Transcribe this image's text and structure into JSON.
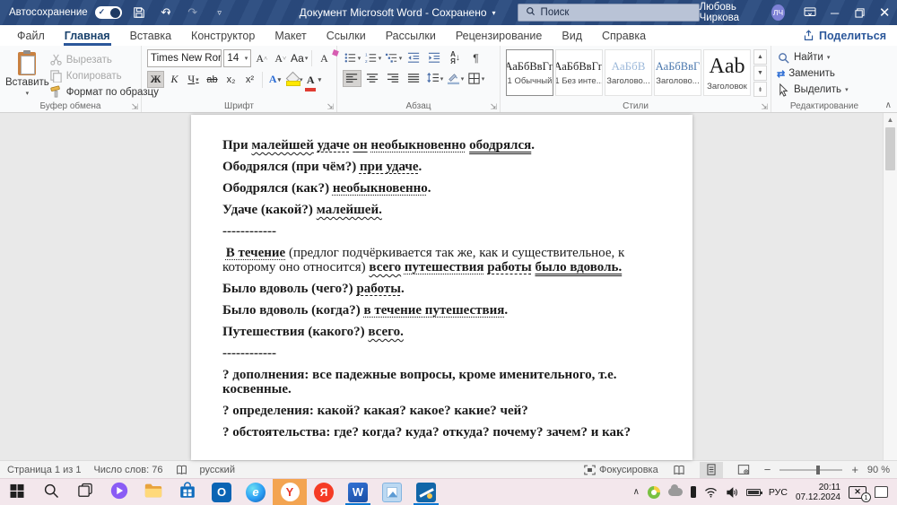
{
  "titlebar": {
    "autosave_label": "Автосохранение",
    "doc_title": "Документ Microsoft Word - Сохранено",
    "search_placeholder": "Поиск",
    "user_name": "Любовь Чиркова",
    "user_initials": "ЛЧ"
  },
  "tabs": {
    "items": [
      "Файл",
      "Главная",
      "Вставка",
      "Конструктор",
      "Макет",
      "Ссылки",
      "Рассылки",
      "Рецензирование",
      "Вид",
      "Справка"
    ],
    "active": "Главная",
    "share_label": "Поделиться"
  },
  "ribbon": {
    "clipboard": {
      "paste": "Вставить",
      "cut": "Вырезать",
      "copy": "Копировать",
      "format_painter": "Формат по образцу",
      "group": "Буфер обмена"
    },
    "font": {
      "family": "Times New Ror",
      "size": "14",
      "bold": "Ж",
      "italic": "K",
      "underline": "Ч",
      "strike": "ab",
      "sub": "x₂",
      "sup": "x²",
      "effects": "А",
      "case_btn": "Аа",
      "grow": "А",
      "shrink": "А",
      "clear": "А",
      "color": "А",
      "group": "Шрифт"
    },
    "paragraph": {
      "sort_top": "А",
      "sort_bottom": "Я",
      "pilcrow": "¶",
      "group": "Абзац"
    },
    "styles": {
      "group": "Стили",
      "items": [
        {
          "preview": "АаБбВвГг,",
          "name": "1 Обычный",
          "variant": "normal",
          "selected": true
        },
        {
          "preview": "АаБбВвГг,",
          "name": "1 Без инте...",
          "variant": "normal",
          "selected": false
        },
        {
          "preview": "АаБбВ",
          "name": "Заголово...",
          "variant": "h1",
          "selected": false
        },
        {
          "preview": "АаБбВвГ",
          "name": "Заголово...",
          "variant": "h2",
          "selected": false
        },
        {
          "preview": "Aab",
          "name": "Заголовок",
          "variant": "title",
          "selected": false
        }
      ]
    },
    "editing": {
      "find": "Найти",
      "replace": "Заменить",
      "select": "Выделить",
      "group": "Редактирование"
    }
  },
  "document": {
    "lines": [
      {
        "segments": [
          {
            "t": "При "
          },
          {
            "t": "малейшей",
            "u": "wavy"
          },
          {
            "t": " "
          },
          {
            "t": "удаче",
            "u": "dashed"
          },
          {
            "t": " "
          },
          {
            "t": "он",
            "u": "solid"
          },
          {
            "t": " "
          },
          {
            "t": "необыкновенно",
            "u": "dotted"
          },
          {
            "t": " "
          },
          {
            "t": "ободрялся",
            "u": "double"
          },
          {
            "t": "."
          }
        ]
      },
      {
        "segments": [
          {
            "t": "Ободрялся (при чём?) "
          },
          {
            "t": "при удаче",
            "u": "dashed"
          },
          {
            "t": "."
          }
        ]
      },
      {
        "segments": [
          {
            "t": "Ободрялся (как?) "
          },
          {
            "t": "необыкновенно",
            "u": "dotted"
          },
          {
            "t": "."
          }
        ]
      },
      {
        "segments": [
          {
            "t": "Удаче (какой?) "
          },
          {
            "t": "малейшей.",
            "u": "wavy"
          }
        ]
      },
      {
        "segments": [
          {
            "t": "------------"
          }
        ]
      },
      {
        "segments": [
          {
            "t": " "
          },
          {
            "t": "В течение",
            "u": "dotted"
          },
          {
            "t": " "
          },
          {
            "t": "(предлог подчёркивается так же, как и существительное, к которому оно относится) ",
            "n": true
          },
          {
            "t": "всего",
            "u": "wavy"
          },
          {
            "t": " "
          },
          {
            "t": "путешествия",
            "u": "dotted"
          },
          {
            "t": " "
          },
          {
            "t": "работы",
            "u": "dashed"
          },
          {
            "t": " "
          },
          {
            "t": "было вдоволь.",
            "u": "double"
          }
        ]
      },
      {
        "segments": [
          {
            "t": "Было вдоволь (чего?) "
          },
          {
            "t": "работы",
            "u": "dashed"
          },
          {
            "t": "."
          }
        ]
      },
      {
        "segments": [
          {
            "t": "Было вдоволь (когда?) "
          },
          {
            "t": "в течение путешествия",
            "u": "dotted"
          },
          {
            "t": "."
          }
        ]
      },
      {
        "segments": [
          {
            "t": "Путешествия (какого?) "
          },
          {
            "t": "всего.",
            "u": "wavy"
          }
        ]
      },
      {
        "segments": [
          {
            "t": "------------"
          }
        ]
      },
      {
        "segments": [
          {
            "t": "? дополнения: все падежные вопросы, кроме именительного, т.е. косвенные."
          }
        ]
      },
      {
        "segments": [
          {
            "t": "? определения: какой? какая? какое? какие? чей?"
          }
        ]
      },
      {
        "segments": [
          {
            "t": "? обстоятельства: где? когда? куда? откуда? почему? зачем? и как?"
          }
        ]
      }
    ]
  },
  "statusbar": {
    "page": "Страница 1 из 1",
    "words": "Число слов: 76",
    "language": "русский",
    "focus": "Фокусировка",
    "zoom": "90 %"
  },
  "taskbar": {
    "apps": [
      {
        "name": "start"
      },
      {
        "name": "search"
      },
      {
        "name": "task-view"
      },
      {
        "name": "alice"
      },
      {
        "name": "explorer"
      },
      {
        "name": "store"
      },
      {
        "name": "outlook",
        "glyph": "O",
        "cls": "tile outlook"
      },
      {
        "name": "edge",
        "glyph": "e",
        "cls": "tile edge"
      },
      {
        "name": "yandex-browser",
        "glyph": "Y",
        "cls": "circle ybrowser",
        "highlight": true
      },
      {
        "name": "yandex",
        "glyph": "Я",
        "cls": "circle yandex"
      },
      {
        "name": "word",
        "glyph": "W",
        "cls": "tile word",
        "active": true
      },
      {
        "name": "photos",
        "cls": "photos-ic"
      },
      {
        "name": "snipping",
        "cls": "snip-ic",
        "active": true
      }
    ],
    "tray": {
      "lang": "РУС",
      "time": "20:11",
      "date": "07.12.2024",
      "badge": "1"
    }
  }
}
